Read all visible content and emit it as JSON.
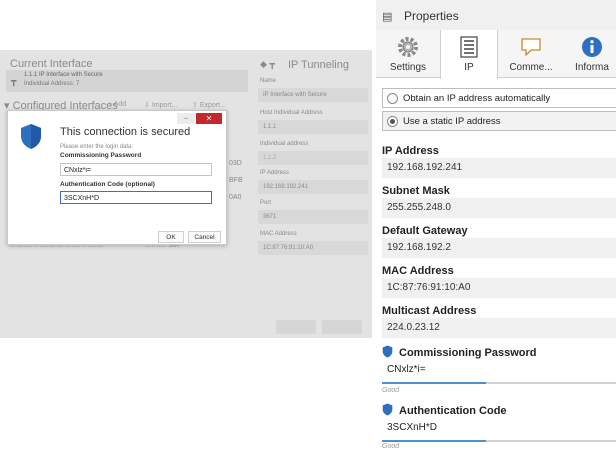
{
  "background": {
    "current_interface": {
      "heading": "Current Interface",
      "line1": "1.1.1 IP Interface with Secure",
      "line2": "Individual Address: 7"
    },
    "configured": {
      "heading": "Configured Interfaces",
      "add": "Add",
      "import": "Import...",
      "export": "Export...",
      "row_codes": [
        "03D",
        "BFB",
        "0A0"
      ],
      "last_row_left": "... ......... ... ......... .... ......... ... .........",
      "last_row_right": "...... ...... .067"
    },
    "tunneling": {
      "heading": "IP Tunneling",
      "fields": [
        {
          "label": "Name",
          "value": "IP Interface with Secure"
        },
        {
          "label": "Host Individual Address",
          "value": "1.1.1"
        },
        {
          "label": "Individual address",
          "value": "1.1.2"
        },
        {
          "label": "IP Address",
          "value": "192.168.192.241"
        },
        {
          "label": "Port",
          "value": "3671"
        },
        {
          "label": "MAC Address",
          "value": "1C:87:76:91:10:A0"
        }
      ]
    }
  },
  "dialog": {
    "title": "This connection is secured",
    "hint": "Please enter the login data:",
    "password_label": "Commissioning Password",
    "password_value": "CNxlz*i=",
    "auth_label": "Authentication Code (optional)",
    "auth_value": "3SCXnH*D",
    "ok_label": "OK",
    "cancel_label": "Cancel"
  },
  "properties": {
    "title": "Properties",
    "tabs": [
      {
        "label": "Settings",
        "icon": "gear-icon"
      },
      {
        "label": "IP",
        "icon": "document-list-icon"
      },
      {
        "label": "Comme...",
        "icon": "comment-icon"
      },
      {
        "label": "Informa",
        "icon": "info-icon"
      }
    ],
    "radio_auto": "Obtain an IP address automatically",
    "radio_static": "Use a static IP address",
    "ip_label": "IP Address",
    "ip_value": "192.168.192.241",
    "subnet_label": "Subnet Mask",
    "subnet_value": "255.255.248.0",
    "gateway_label": "Default Gateway",
    "gateway_value": "192.168.192.2",
    "mac_label": "MAC Address",
    "mac_value": "1C:87:76:91:10:A0",
    "multicast_label": "Multicast Address",
    "multicast_value": "224.0.23.12",
    "commissioning_label": "Commissioning Password",
    "commissioning_value": "CNxlz*i=",
    "commissioning_strength": "Good",
    "auth_label": "Authentication Code",
    "auth_value": "3SCXnH*D",
    "auth_strength": "Good"
  },
  "colors": {
    "accent_blue": "#2f6fbf",
    "close_red": "#c7262c"
  }
}
